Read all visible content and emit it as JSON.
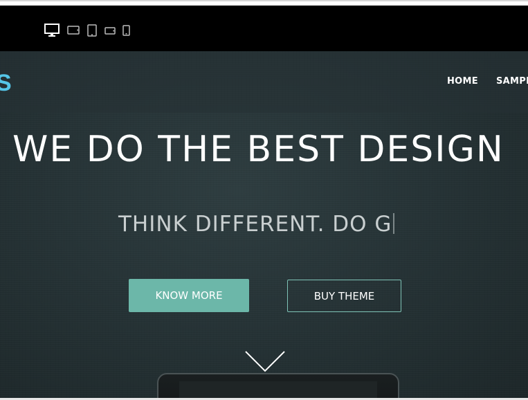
{
  "device_bar": {
    "icons": [
      "desktop-icon",
      "tablet-landscape-icon",
      "tablet-portrait-icon",
      "phone-landscape-icon",
      "phone-portrait-icon"
    ]
  },
  "navbar": {
    "logo_text": "S",
    "links": [
      "HOME",
      "SAMPL"
    ]
  },
  "hero": {
    "headline": "WE DO THE BEST DESIGN",
    "subline": "THINK DIFFERENT. DO G",
    "primary_button": "KNOW MORE",
    "secondary_button": "BUY THEME",
    "scroll_icon": "chevron-down-icon"
  },
  "colors": {
    "device_bar_bg": "#000000",
    "hero_bg": "#263336",
    "logo_accent": "#55c6e8",
    "primary_button": "#6cb7a9",
    "outline_border": "#7fc4b7"
  }
}
